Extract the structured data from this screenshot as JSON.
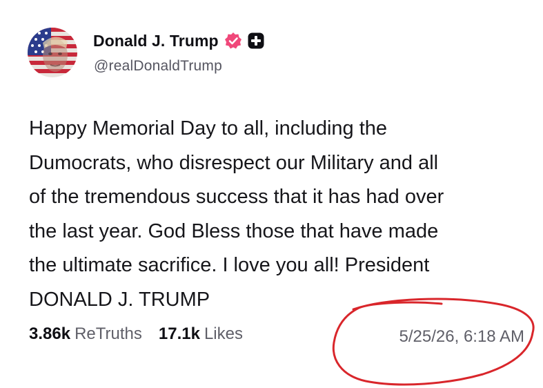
{
  "author": {
    "display_name": "Donald J. Trump",
    "handle": "@realDonaldTrump",
    "avatar_icon": "flag-portrait-avatar",
    "verified_icon": "verified-badge-icon",
    "badge_icon": "plus-badge-icon"
  },
  "post": {
    "lines": [
      "Happy Memorial Day to all, including the",
      "Dumocrats, who disrespect our Military and all",
      "of the tremendous success that it has had over",
      "the last year. God Bless those that have made",
      "the ultimate sacrifice. I love you all! President",
      "DONALD J. TRUMP"
    ]
  },
  "stats": {
    "retruths_count": "3.86k",
    "retruths_label": "ReTruths",
    "likes_count": "17.1k",
    "likes_label": "Likes"
  },
  "timestamp": "5/25/26, 6:18 AM",
  "colors": {
    "verified_badge": "#f0487a",
    "annotation_circle": "#d9262b"
  }
}
